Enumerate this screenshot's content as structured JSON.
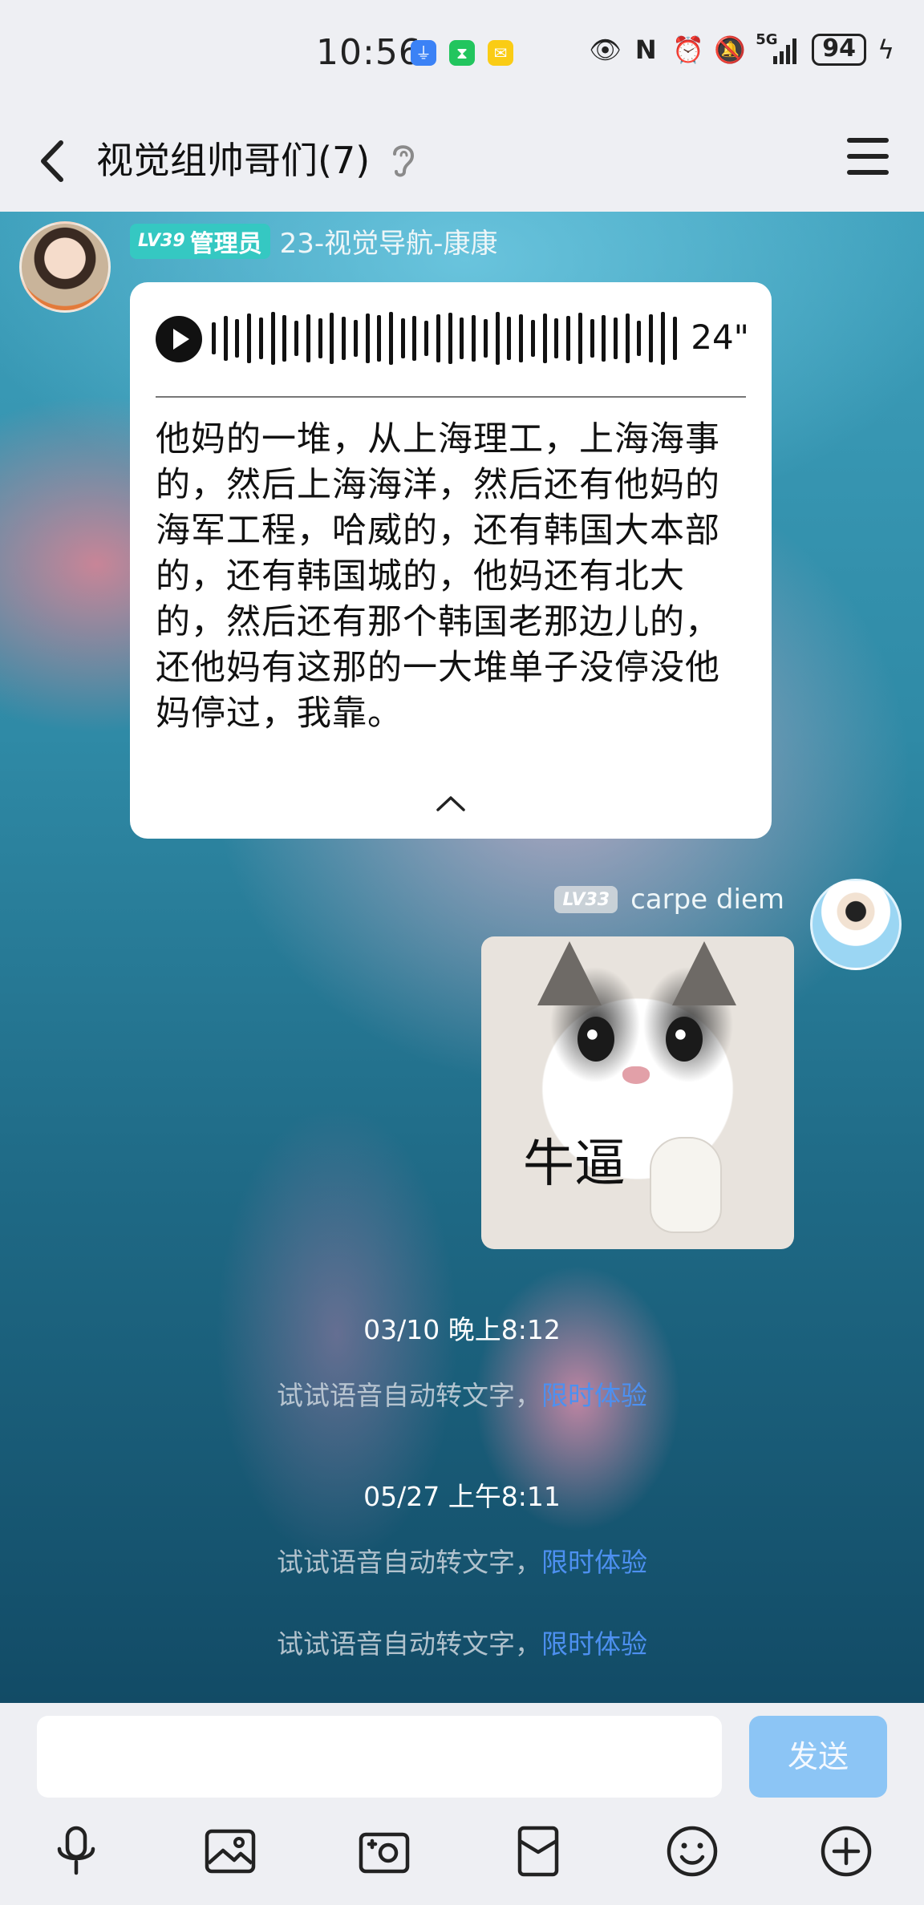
{
  "status_bar": {
    "time": "10:56",
    "network": "5G",
    "battery": "94"
  },
  "header": {
    "title": "视觉组帅哥们(7)"
  },
  "messages": [
    {
      "type": "voice",
      "level": "LV39",
      "role": "管理员",
      "sender": "23-视觉导航-康康",
      "duration": "24\"",
      "transcript": "他妈的一堆，从上海理工，上海海事的，然后上海海洋，然后还有他妈的海军工程，哈威的，还有韩国大本部的，还有韩国城的，他妈还有北大的，然后还有那个韩国老那边儿的，还他妈有这那的一大堆单子没停没他妈停过，我靠。"
    },
    {
      "type": "sticker",
      "level": "LV33",
      "sender": "carpe diem",
      "sticker_text": "牛逼"
    }
  ],
  "timeline": [
    {
      "time": "03/10 晚上8:12",
      "hint": "试试语音自动转文字，",
      "hint_link": "限时体验"
    },
    {
      "time": "05/27 上午8:11",
      "hint": "试试语音自动转文字，",
      "hint_link": "限时体验"
    },
    {
      "hint": "试试语音自动转文字，",
      "hint_link": "限时体验"
    }
  ],
  "input_bar": {
    "placeholder": "",
    "send_label": "发送",
    "tools": [
      "microphone-icon",
      "image-icon",
      "camera-icon",
      "red-packet-icon",
      "emoji-icon",
      "plus-icon"
    ]
  }
}
